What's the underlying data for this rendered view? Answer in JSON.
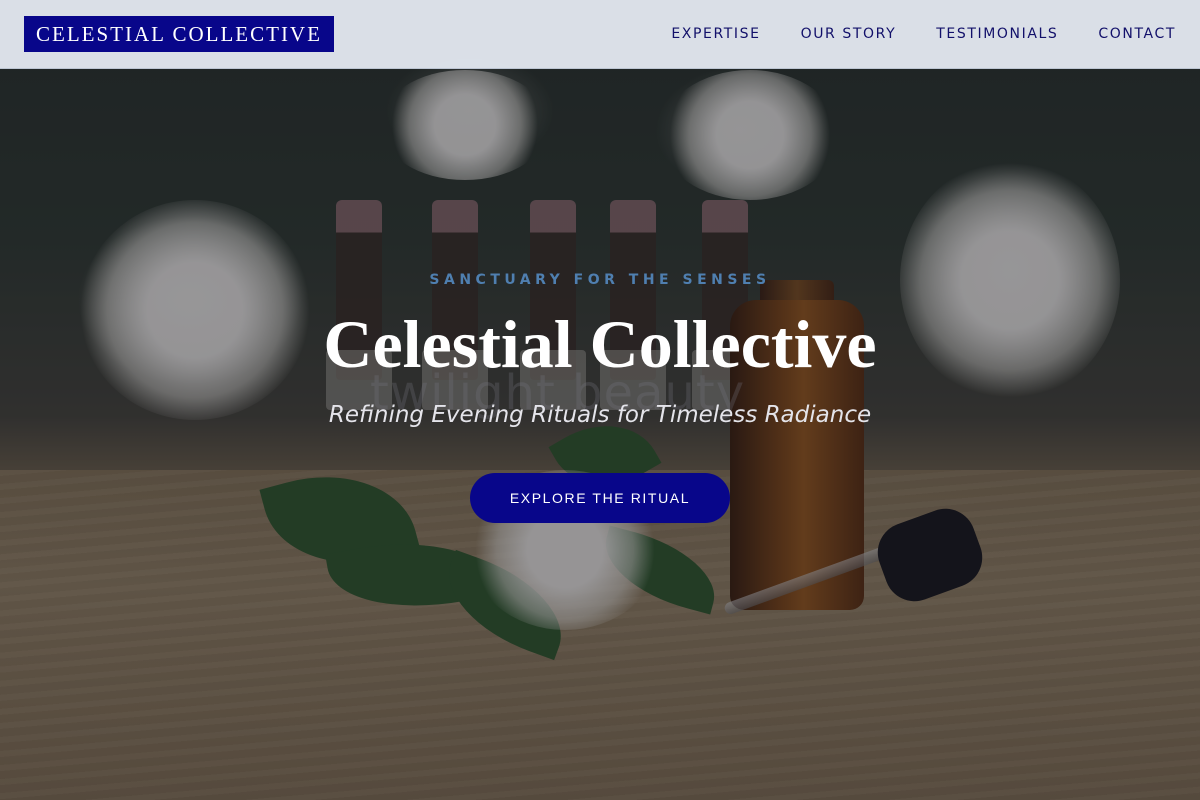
{
  "nav": {
    "logo": "CELESTIAL COLLECTIVE",
    "items": [
      "EXPERTISE",
      "OUR STORY",
      "TESTIMONIALS",
      "CONTACT"
    ]
  },
  "hero": {
    "eyebrow": "SANCTUARY FOR THE SENSES",
    "title": "Celestial Collective",
    "subtitle": "Refining Evening Rituals for Timeless Radiance",
    "cta": "EXPLORE THE RITUAL",
    "ghost_text": "twilight beauty"
  },
  "colors": {
    "brand_navy": "#08068a",
    "nav_background": "#e8eef6",
    "eyebrow_blue": "#4f7fb0"
  }
}
